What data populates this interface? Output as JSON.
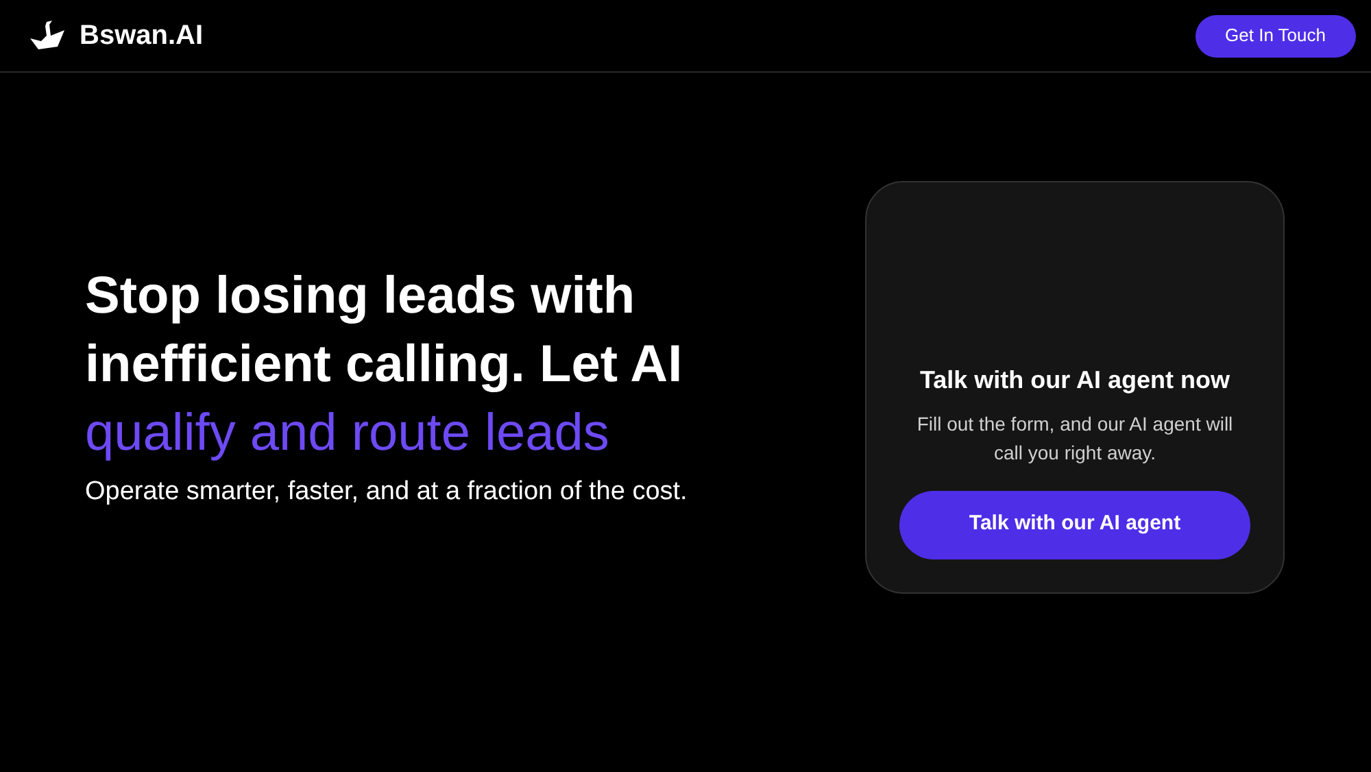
{
  "header": {
    "brand": "Bswan.AI",
    "cta": "Get In Touch"
  },
  "hero": {
    "headline": [
      {
        "text": "Stop losing leads with",
        "highlight": false
      },
      {
        "text": "inefficient calling. Let AI",
        "highlight": false
      },
      {
        "text": "qualify and route leads",
        "highlight": true
      }
    ],
    "subtitle": "Operate smarter, faster, and at a fraction of the cost."
  },
  "card": {
    "title": "Talk with our AI agent now",
    "description": "Fill out the form, and our AI agent will call you right away.",
    "button": "Talk with our AI agent"
  }
}
